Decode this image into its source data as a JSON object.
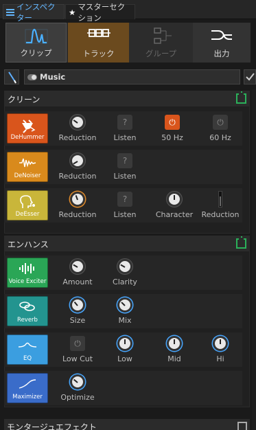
{
  "tabs": [
    {
      "label": "インスペクター",
      "active": true,
      "icon": "hamburger-icon"
    },
    {
      "label": "マスターセクション",
      "active": false,
      "icon": "star-icon"
    }
  ],
  "modes": [
    {
      "label": "クリップ",
      "icon": "clip-wave-icon",
      "state": "normal"
    },
    {
      "label": "トラック",
      "icon": "track-icon",
      "state": "selected"
    },
    {
      "label": "グループ",
      "icon": "group-icon",
      "state": "disabled"
    },
    {
      "label": "出力",
      "icon": "output-icon",
      "state": "normal"
    }
  ],
  "track": {
    "name": "Music"
  },
  "sections": {
    "clean": {
      "title": "クリーン",
      "modules": [
        {
          "name": "DeHummer",
          "color": "#d9551c",
          "icon": "plug-icon",
          "controls": [
            "Reduction",
            "Listen",
            "50 Hz",
            "60 Hz"
          ]
        },
        {
          "name": "DeNoiser",
          "color": "#d98a1c",
          "icon": "noise-wave-icon",
          "controls": [
            "Reduction",
            "Listen"
          ]
        },
        {
          "name": "DeEsser",
          "color": "#c9b63a",
          "icon": "head-icon",
          "controls": [
            "Reduction",
            "Listen",
            "Character",
            "Reduction"
          ]
        }
      ]
    },
    "enhance": {
      "title": "エンハンス",
      "modules": [
        {
          "name": "Voice Exciter",
          "color": "#2aa656",
          "icon": "voice-bars-icon",
          "controls": [
            "Amount",
            "Clarity"
          ]
        },
        {
          "name": "Reverb",
          "color": "#23948f",
          "icon": "reverb-icon",
          "controls": [
            "Size",
            "Mix"
          ]
        },
        {
          "name": "EQ",
          "color": "#3b9ee0",
          "icon": "eq-curve-icon",
          "controls": [
            "Low Cut",
            "Low",
            "Mid",
            "Hi"
          ]
        },
        {
          "name": "Maximizer",
          "color": "#3a6cc9",
          "icon": "maximizer-curve-icon",
          "controls": [
            "Optimize"
          ]
        }
      ]
    },
    "montage": {
      "title": "モンタージュエフェクト"
    }
  },
  "colors": {
    "accent": "#46a6ff",
    "power_on": "#2bb15a",
    "track_selected": "#6b4a1e"
  }
}
